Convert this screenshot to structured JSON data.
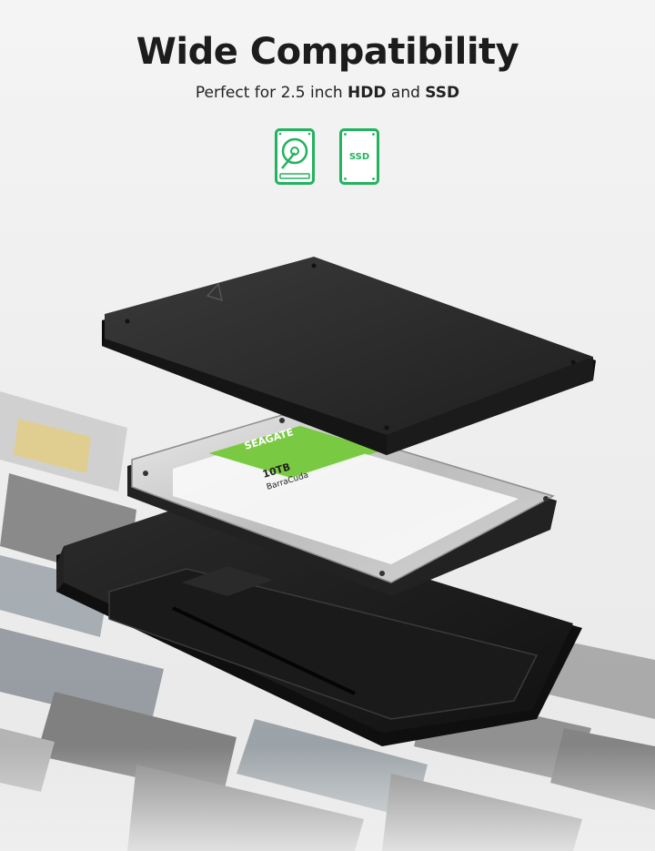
{
  "header": {
    "title": "Wide Compatibility",
    "subtitle_prefix": "Perfect for 2.5 inch ",
    "subtitle_hdd": "HDD",
    "subtitle_and": " and ",
    "subtitle_ssd": "SSD"
  },
  "icons": {
    "hdd": "hard-drive-icon",
    "ssd": "ssd-icon",
    "ssd_label": "SSD",
    "accent_color": "#22b35e"
  },
  "drive": {
    "brand": "SEAGATE",
    "series": "BarraCuda",
    "capacity": "10TB",
    "label_color": "#7ac943"
  }
}
